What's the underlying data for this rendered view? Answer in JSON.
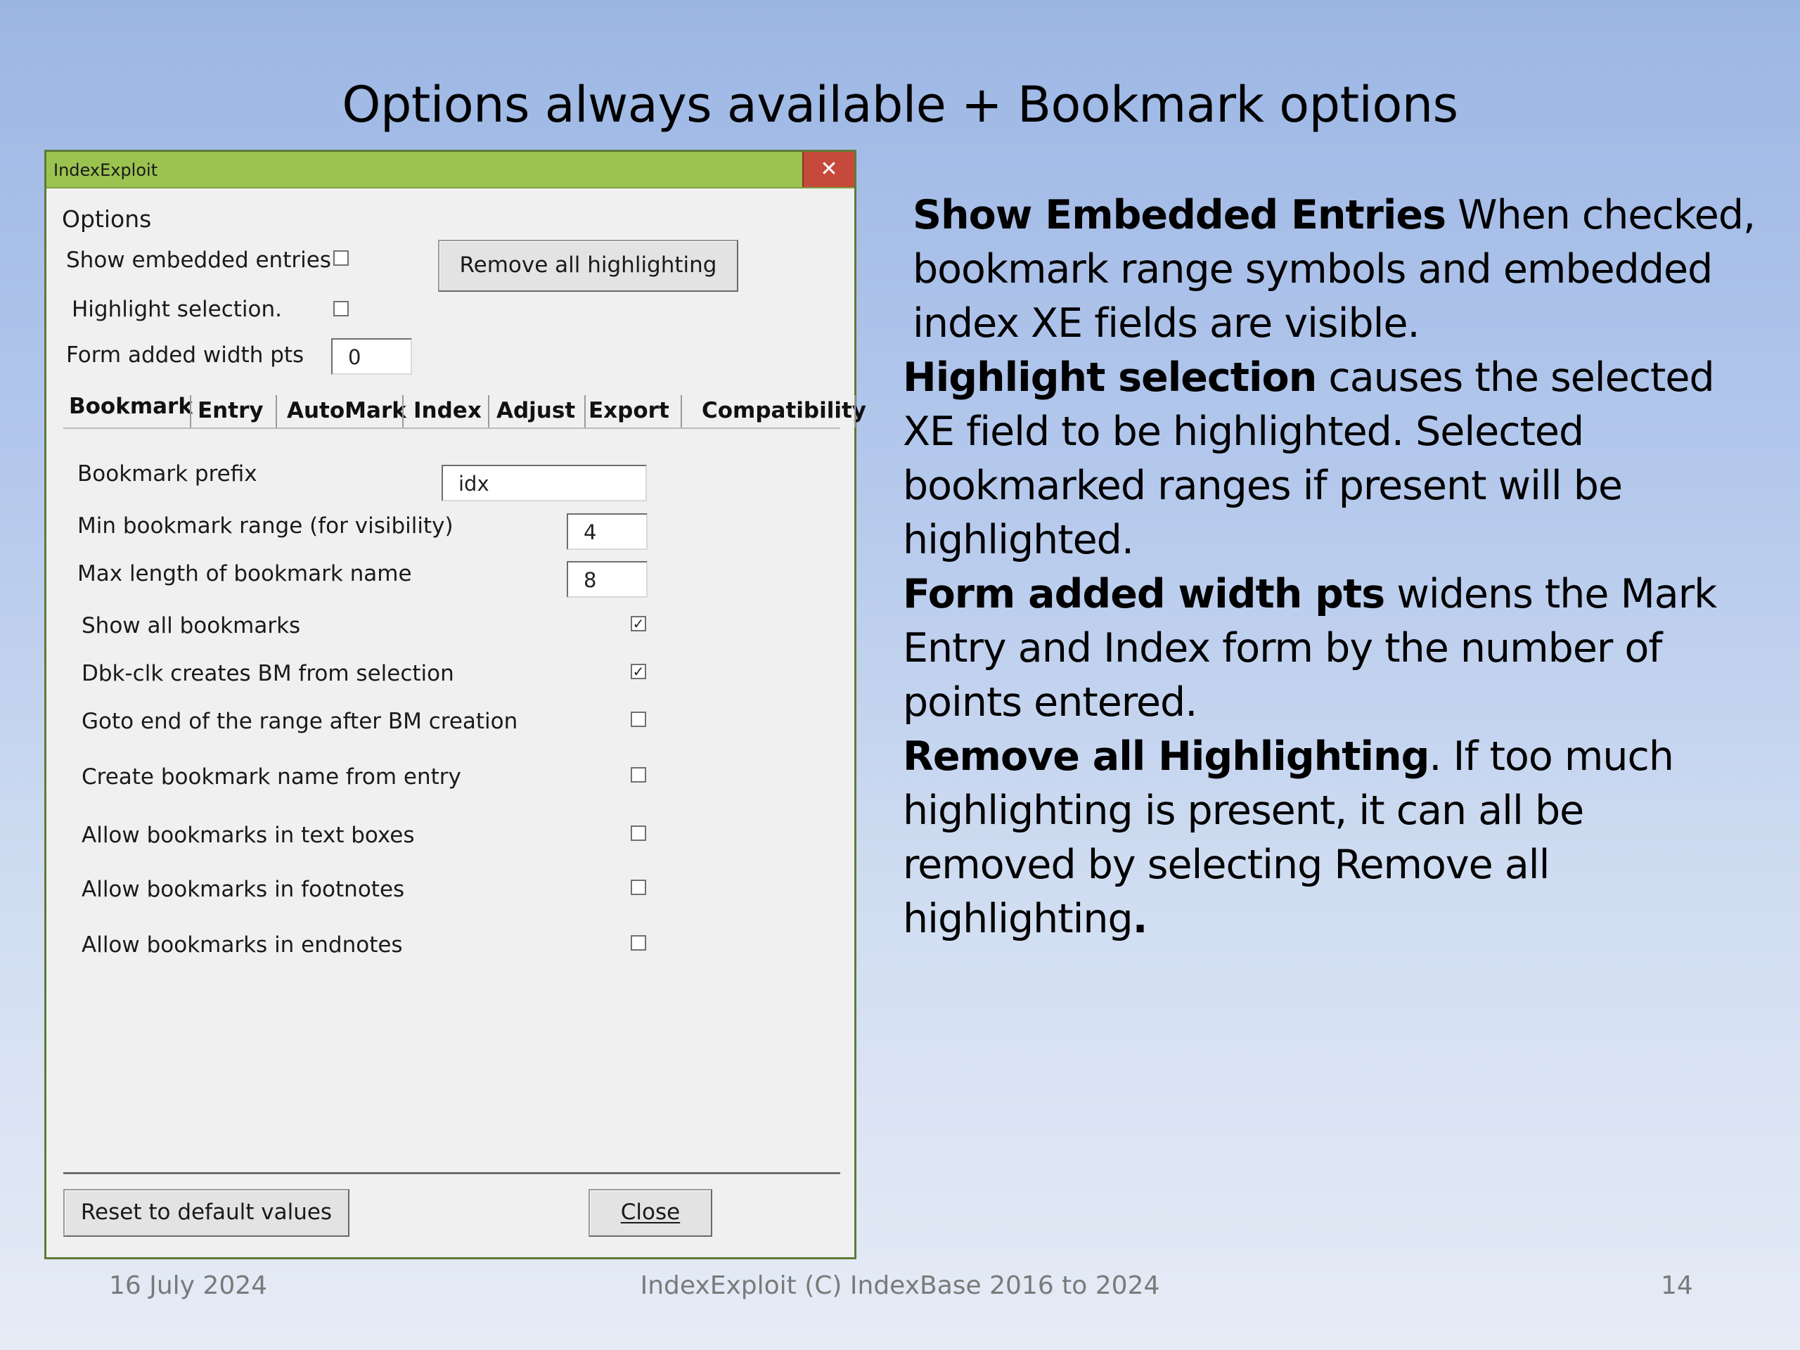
{
  "slide": {
    "title": "Options always available + Bookmark options",
    "footer_date": "16 July 2024",
    "footer_center": "IndexExploit (C) IndexBase 2016 to 2024",
    "page_number": "14"
  },
  "dialog": {
    "title": "IndexExploit",
    "close_glyph": "✕",
    "options_heading": "Options",
    "show_embedded_label": "Show embedded entries",
    "show_embedded_checked": false,
    "highlight_selection_label": "Highlight selection.",
    "highlight_selection_checked": false,
    "form_width_label": "Form added width pts",
    "form_width_value": "0",
    "remove_highlighting_button": "Remove all highlighting",
    "tabs": [
      "Bookmark",
      "Entry",
      "AutoMark",
      "Index",
      "Adjust",
      "Export",
      "Compatibility"
    ],
    "active_tab": "Bookmark",
    "bookmark": {
      "prefix_label": "Bookmark prefix",
      "prefix_value": "idx",
      "min_range_label": "Min bookmark range (for visibility)",
      "min_range_value": "4",
      "max_length_label": "Max length of bookmark name",
      "max_length_value": "8",
      "checks": [
        {
          "label": "Show all bookmarks",
          "mark": "✓"
        },
        {
          "label": "Dbk-clk creates BM from selection",
          "mark": "✓"
        },
        {
          "label": "Goto end of the range after BM creation",
          "mark": ""
        },
        {
          "label": "Create bookmark name from entry",
          "mark": ""
        },
        {
          "label": "Allow bookmarks in text boxes",
          "mark": ""
        },
        {
          "label": "Allow bookmarks in footnotes",
          "mark": ""
        },
        {
          "label": "Allow bookmarks in endnotes",
          "mark": ""
        }
      ]
    },
    "reset_button": "Reset to default values",
    "close_button": "Close"
  },
  "description": {
    "p1_bold": "Show Embedded Entries",
    "p1_text": " When checked, bookmark range symbols and embedded index XE fields are visible.",
    "p2_bold": "Highlight selection",
    "p2_text": " causes the selected XE field to be highlighted. Selected bookmarked ranges if present will be highlighted.",
    "p3_bold": "Form added width pts",
    "p3_text": " widens the Mark Entry and Index form by the number of points entered.",
    "p4_bold": "Remove all Highlighting",
    "p4_text": ". If  too much highlighting is present, it can all be removed by selecting Remove all highlighting",
    "p4_end_bold": "."
  }
}
